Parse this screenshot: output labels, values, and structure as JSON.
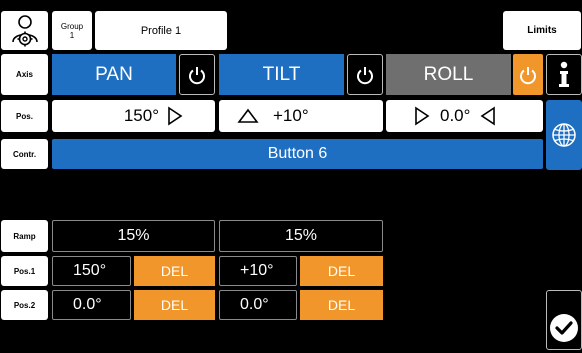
{
  "header": {
    "group_label": "Group",
    "group_number": "1",
    "profile_label": "Profile 1",
    "limits_label": "Limits"
  },
  "row_labels": {
    "axis": "Axis",
    "pos": "Pos.",
    "contr": "Contr.",
    "ramp": "Ramp",
    "pos1": "Pos.1",
    "pos2": "Pos.2"
  },
  "axes": {
    "pan": {
      "label": "PAN",
      "value": "150°",
      "power_state": "on"
    },
    "tilt": {
      "label": "TILT",
      "value": "+10°",
      "power_state": "on"
    },
    "roll": {
      "label": "ROLL",
      "value": "0.0°",
      "power_state": "off"
    }
  },
  "controller": {
    "value": "Button 6"
  },
  "ramp": {
    "values": [
      "15%",
      "15%"
    ]
  },
  "positions": {
    "pos1": [
      {
        "value": "150°",
        "del_label": "DEL"
      },
      {
        "value": "+10°",
        "del_label": "DEL"
      }
    ],
    "pos2": [
      {
        "value": "0.0°",
        "del_label": "DEL"
      },
      {
        "value": "0.0°",
        "del_label": "DEL"
      }
    ]
  },
  "icons": {
    "user_settings": "user-settings-icon",
    "info": "info-icon",
    "globe": "globe-icon",
    "confirm": "checkmark-icon",
    "power": "power-icon"
  },
  "colors": {
    "blue": "#1e6fc1",
    "orange": "#f0962a",
    "gray": "#6f6f6f",
    "background": "#000000"
  }
}
